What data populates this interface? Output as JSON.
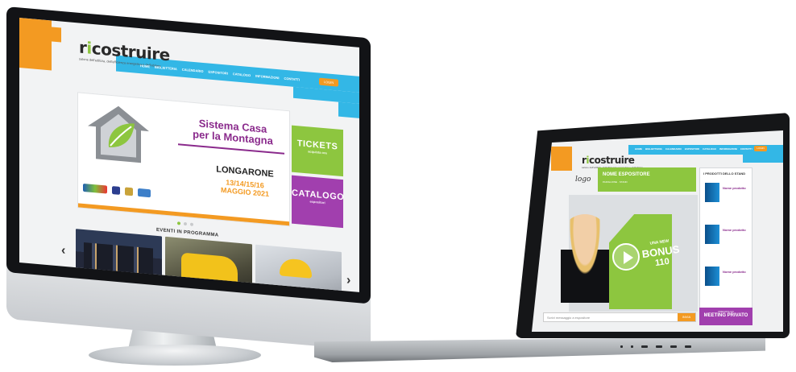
{
  "desktop_site": {
    "logo": {
      "prefix": "r",
      "i": "i",
      "suffix": "costruire"
    },
    "tagline": "salone dell'edilizia, dell'efficienza energetica e dell'abitare",
    "nav": [
      "HOME",
      "BIGLIETTERIA",
      "CALENDARIO",
      "ESPOSITORI",
      "CATALOGO",
      "INFORMAZIONI",
      "CONTATTI"
    ],
    "nav_button": "LOGIN",
    "hero": {
      "title_line1": "Sistema Casa",
      "title_line2": "per la Montagna",
      "city": "LONGARONE",
      "dates": "13/14/15/16",
      "month": "MAGGIO 2021"
    },
    "tile_tickets": {
      "label": "TICKETS",
      "sub": "acquista ora"
    },
    "tile_catalog": {
      "label": "CATALOGO",
      "sub": "espositori"
    },
    "events_title": "EVENTI IN PROGRAMMA",
    "prev_arrow": "‹",
    "next_arrow": "›"
  },
  "laptop_site": {
    "logo": {
      "prefix": "r",
      "i": "i",
      "suffix": "costruire"
    },
    "tagline": "salone dell'edilizia, dell'efficienza energetica e dell'abitare",
    "nav": [
      "HOME",
      "BIGLIETTERIA",
      "CALENDARIO",
      "ESPOSITORI",
      "CATALOGO",
      "INFORMAZIONI",
      "CONTATTI"
    ],
    "nav_button": "LOGIN",
    "exhibitor_logo": "logo",
    "exhibitor_name": "NOME ESPOSITORE",
    "exhibitor_sub": "PADIGLIONE · STAND",
    "bonus_line1": "UNA NEW",
    "bonus_line2": "BONUS",
    "bonus_line3": "110",
    "side_title": "I PRODOTTI DELLO STAND",
    "products": [
      {
        "name": "Nome prodotto"
      },
      {
        "name": "Nome prodotto"
      },
      {
        "name": "Nome prodotto"
      }
    ],
    "search_placeholder": "Scrivi messaggio a espositore",
    "search_button": "INVIA",
    "meeting_sub": "PRENOTA UN",
    "meeting_label": "MEETING PRIVATO"
  },
  "colors": {
    "orange": "#f39a22",
    "blue": "#33b7e6",
    "green": "#8dc63f",
    "purple": "#a13fae"
  }
}
